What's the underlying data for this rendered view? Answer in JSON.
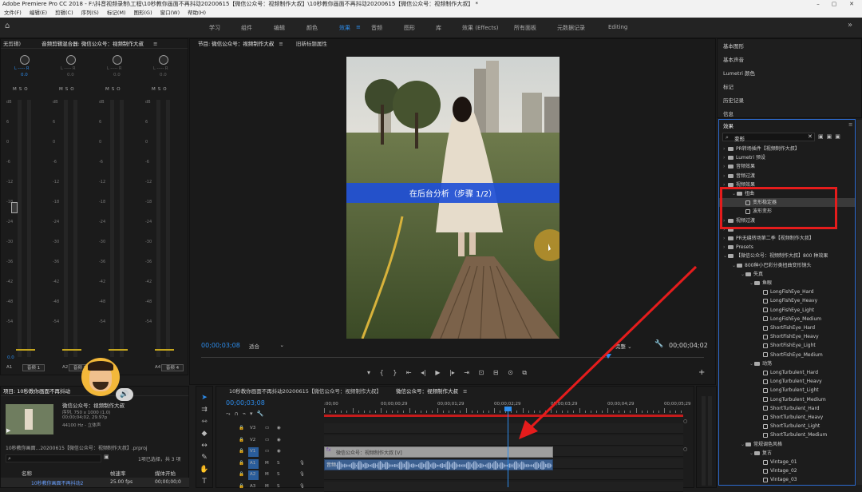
{
  "title_bar": {
    "app_title": "Adobe Premiere Pro CC 2018 - F:\\抖音视频录制\\工程\\10秒教你画面不再抖动20200615【微信公众号：视频制作大叔】\\10秒教你画面不再抖动20200615【微信公众号：视频制作大叔】 *"
  },
  "menu": [
    "文件(F)",
    "编辑(E)",
    "剪辑(C)",
    "序列(S)",
    "标记(M)",
    "图形(G)",
    "窗口(W)",
    "帮助(H)"
  ],
  "workspaces": [
    "学习",
    "组件",
    "编辑",
    "颜色",
    "效果",
    "音频",
    "图形",
    "库",
    "效果 (Effects)",
    "所有面板",
    "元数据记录",
    "Editing"
  ],
  "active_workspace": "效果",
  "audio_mixer": {
    "left_tab": "无剪辑)",
    "tab": "音频剪辑混合器: 微信公众号：视频制作大叔",
    "knob_label": "L",
    "knob_right": "R",
    "knob_value": "0.0",
    "msr": [
      "M",
      "S",
      "O"
    ],
    "db_scale": [
      "dB",
      "6",
      "0",
      "-6",
      "-12",
      "-18",
      "-24",
      "-30",
      "-36",
      "-42",
      "-48",
      "-54"
    ],
    "bottom_value": "0.0",
    "tracks": [
      {
        "id": "A1",
        "name": "音频 1"
      },
      {
        "id": "A2",
        "name": "音频 2"
      },
      {
        "id": "A3",
        "name": ""
      },
      {
        "id": "A4",
        "name": "音频 4"
      }
    ]
  },
  "program_monitor": {
    "tab": "节目: 微信公众号：视频制作大叔",
    "tab2": "旧新标题属性",
    "subtitle": "在后台分析（步骤 1/2）",
    "timecode_left": "00;00;03;08",
    "fit": "适合",
    "quality": "完整",
    "timecode_right": "00;00;04;02"
  },
  "right_panels": [
    "基本图形",
    "基本声音",
    "Lumetri 颜色",
    "标记",
    "历史记录",
    "信息"
  ],
  "effects_panel": {
    "tab": "效果",
    "search_value": "变形",
    "items": [
      {
        "label": "PR转场插件【视频制作大叔】",
        "depth": 0,
        "kind": "folder"
      },
      {
        "label": "Lumetri 预设",
        "depth": 0,
        "kind": "folder"
      },
      {
        "label": "音频效果",
        "depth": 0,
        "kind": "folder"
      },
      {
        "label": "音频过渡",
        "depth": 0,
        "kind": "folder"
      },
      {
        "label": "视频效果",
        "depth": 0,
        "kind": "folder"
      },
      {
        "label": "扭曲",
        "depth": 1,
        "kind": "folder"
      },
      {
        "label": "变形稳定器",
        "depth": 2,
        "kind": "effect",
        "selected": true
      },
      {
        "label": "波形变形",
        "depth": 2,
        "kind": "effect"
      },
      {
        "label": "视频过渡",
        "depth": 0,
        "kind": "folder"
      },
      {
        "label": "",
        "depth": 0,
        "kind": "folder"
      },
      {
        "label": "PR无缝转场第二季【视频制作大叔】",
        "depth": 0,
        "kind": "folder"
      },
      {
        "label": "Presets",
        "depth": 0,
        "kind": "folder"
      },
      {
        "label": "【微信公众号：视频制作大叔】800 种效果",
        "depth": 0,
        "kind": "folder"
      },
      {
        "label": "800种小巴彩分类扭曲变形镜头",
        "depth": 1,
        "kind": "folder"
      },
      {
        "label": "失真",
        "depth": 2,
        "kind": "folder"
      },
      {
        "label": "鱼眼",
        "depth": 3,
        "kind": "folder"
      },
      {
        "label": "LongFishEye_Hard",
        "depth": 4,
        "kind": "effect"
      },
      {
        "label": "LongFishEye_Heavy",
        "depth": 4,
        "kind": "effect"
      },
      {
        "label": "LongFishEye_Light",
        "depth": 4,
        "kind": "effect"
      },
      {
        "label": "LongFishEye_Medium",
        "depth": 4,
        "kind": "effect"
      },
      {
        "label": "ShortFishEye_Hard",
        "depth": 4,
        "kind": "effect"
      },
      {
        "label": "ShortFishEye_Heavy",
        "depth": 4,
        "kind": "effect"
      },
      {
        "label": "ShortFishEye_Light",
        "depth": 4,
        "kind": "effect"
      },
      {
        "label": "ShortFishEye_Medium",
        "depth": 4,
        "kind": "effect"
      },
      {
        "label": "动荡",
        "depth": 3,
        "kind": "folder"
      },
      {
        "label": "LongTurbulent_Hard",
        "depth": 4,
        "kind": "effect"
      },
      {
        "label": "LongTurbulent_Heavy",
        "depth": 4,
        "kind": "effect"
      },
      {
        "label": "LongTurbulent_Light",
        "depth": 4,
        "kind": "effect"
      },
      {
        "label": "LongTurbulent_Medium",
        "depth": 4,
        "kind": "effect"
      },
      {
        "label": "ShortTurbulent_Hard",
        "depth": 4,
        "kind": "effect"
      },
      {
        "label": "ShortTurbulent_Heavy",
        "depth": 4,
        "kind": "effect"
      },
      {
        "label": "ShortTurbulent_Light",
        "depth": 4,
        "kind": "effect"
      },
      {
        "label": "ShortTurbulent_Medium",
        "depth": 4,
        "kind": "effect"
      },
      {
        "label": "常规调色风格",
        "depth": 2,
        "kind": "folder"
      },
      {
        "label": "复古",
        "depth": 3,
        "kind": "folder"
      },
      {
        "label": "Vintage_01",
        "depth": 4,
        "kind": "effect"
      },
      {
        "label": "Vintage_02",
        "depth": 4,
        "kind": "effect"
      },
      {
        "label": "Vintage_03",
        "depth": 4,
        "kind": "effect"
      }
    ]
  },
  "project_panel": {
    "tab": "项目: 10秒教你画面不再抖动",
    "clip_name": "微信公众号：视频制作大叔",
    "clip_line1": "序列, 750 x 1000 (1.0)",
    "clip_line2": "00;00;04;02, 29.97p",
    "clip_line3": "44100 Hz - 立体声",
    "bin": "10秒教你画面...20200615【微信公众号：视频制作大叔】.prproj",
    "selection": "1项已选择，共 3 项",
    "columns": [
      "名称",
      "帧速率",
      "媒体开始"
    ],
    "row": {
      "name": "10秒教你画面不再抖动2",
      "fps": "25.00 fps",
      "start": "00;00;00;0"
    }
  },
  "timeline": {
    "tab1": "10秒教你画面不再抖动20200615【微信公众号：视频制作大叔】",
    "tab2": "微信公众号：视频制作大叔",
    "timecode": "00;00;03;08",
    "ruler": [
      ":00;00",
      "00;00;00;29",
      "00;00;01;29",
      "00;00;02;29",
      "00;00;03;29",
      "00;00;04;29",
      "00;00;05;29"
    ],
    "tracks": [
      "V3",
      "V2",
      "V1",
      "A1",
      "A2",
      "A3"
    ],
    "video_clip": "微信公众号：视频制作大叔 [V]",
    "audio_clip": "音频"
  }
}
